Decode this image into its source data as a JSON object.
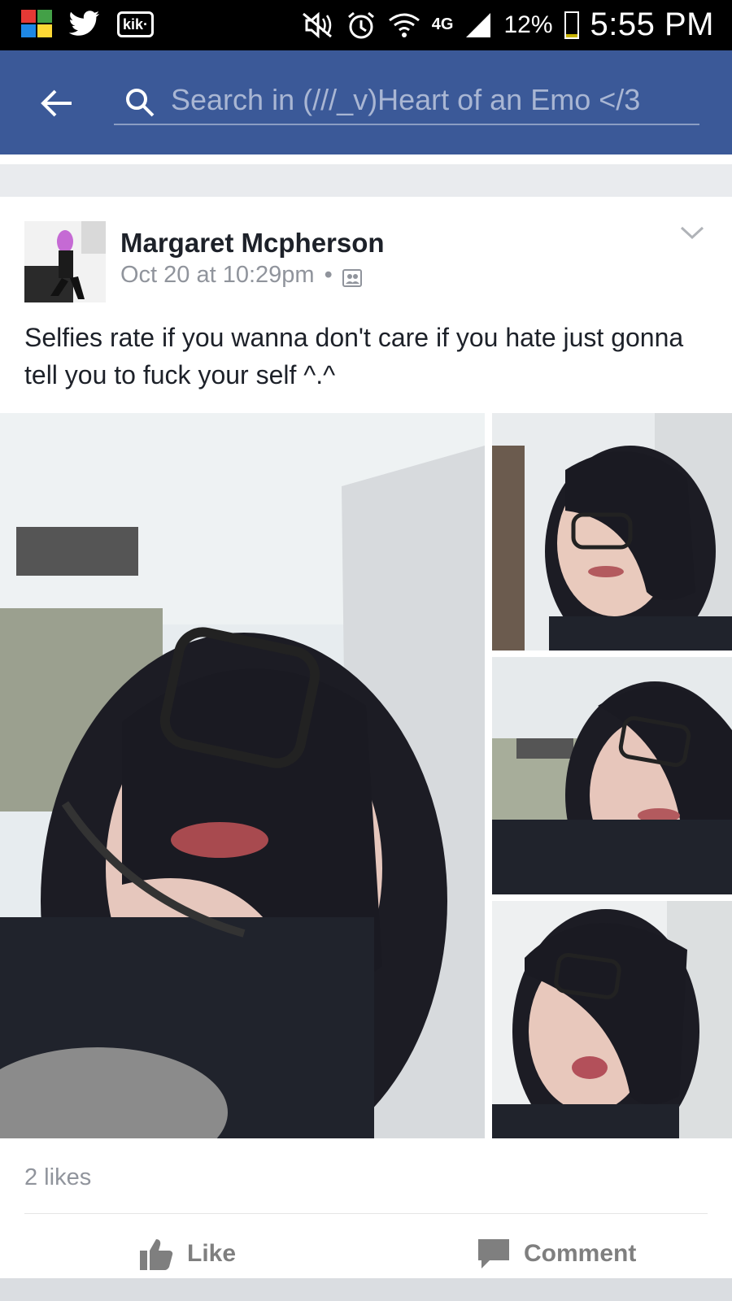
{
  "status_bar": {
    "left_icons": [
      "avg-antivirus-icon",
      "twitter-icon",
      "kik-icon"
    ],
    "kik_label": "kik·",
    "network": "4G",
    "battery": "12%",
    "battery_level": 0.12,
    "time": "5:55 PM"
  },
  "header": {
    "back_icon": "back-arrow-icon",
    "search_placeholder": "Search in (///_v)Heart of an Emo </3",
    "bar_color": "#3b5998"
  },
  "post": {
    "author": "Margaret Mcpherson",
    "timestamp": "Oct 20 at 10:29pm",
    "separator": "•",
    "privacy_icon": "group-icon",
    "text": "Selfies rate if you wanna don't care if you hate just gonna tell you to fuck your self ^.^",
    "photo_count": 4,
    "likes": "2 likes",
    "actions": {
      "like": "Like",
      "comment": "Comment"
    }
  }
}
